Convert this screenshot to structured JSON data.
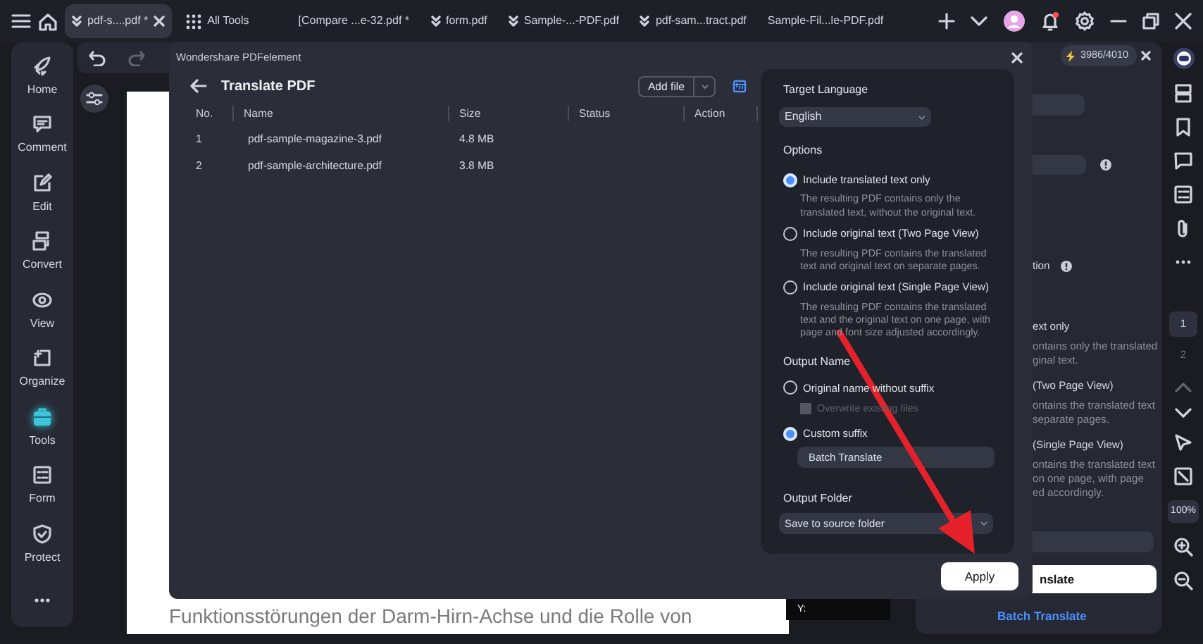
{
  "tabs": [
    {
      "label": "pdf-s....pdf *",
      "selected": true,
      "kind": "file"
    },
    {
      "label": "All Tools",
      "selected": false,
      "kind": "tools"
    },
    {
      "label": "[Compare ...e-32.pdf *",
      "selected": false,
      "kind": "plain"
    },
    {
      "label": "form.pdf",
      "selected": false,
      "kind": "file"
    },
    {
      "label": "Sample-...-PDF.pdf",
      "selected": false,
      "kind": "file"
    },
    {
      "label": "pdf-sam...tract.pdf",
      "selected": false,
      "kind": "file"
    },
    {
      "label": "Sample-Fil...le-PDF.pdf",
      "selected": false,
      "kind": "plain"
    }
  ],
  "sidebar": {
    "items": [
      {
        "label": "Home",
        "selected": false
      },
      {
        "label": "Comment",
        "selected": false
      },
      {
        "label": "Edit",
        "selected": false
      },
      {
        "label": "Convert",
        "selected": false
      },
      {
        "label": "View",
        "selected": false
      },
      {
        "label": "Organize",
        "selected": false
      },
      {
        "label": "Tools",
        "selected": true
      },
      {
        "label": "Form",
        "selected": false
      },
      {
        "label": "Protect",
        "selected": false
      }
    ]
  },
  "document": {
    "text_line": "Funktionsstörungen der Darm-Hirn-Achse und die Rolle von",
    "tooltip": "Y:"
  },
  "right_panel": {
    "credits": "3986/4010",
    "fragments": [
      {
        "text": "tion",
        "info": true
      },
      {
        "text": "ext only",
        "info": false
      },
      {
        "text": "ontains only the translated",
        "info": false
      },
      {
        "text": "ginal text.",
        "info": false
      },
      {
        "text": "(Two Page View)",
        "info": false
      },
      {
        "text": "ontains the translated text",
        "info": false
      },
      {
        "text": "separate pages.",
        "info": false
      },
      {
        "text": "(Single Page View)",
        "info": false
      },
      {
        "text": "ontains the translated text",
        "info": false
      },
      {
        "text": "on one page, with page",
        "info": false
      },
      {
        "text": "ed accordingly.",
        "info": false
      }
    ],
    "button": "nslate",
    "link": "Batch Translate"
  },
  "rail": {
    "pages": [
      {
        "label": "1",
        "selected": true
      },
      {
        "label": "2",
        "selected": false
      }
    ],
    "zoom": "100%"
  },
  "dialog": {
    "app_title": "Wondershare PDFelement",
    "title": "Translate PDF",
    "add_file": "Add file",
    "columns": [
      "No.",
      "Name",
      "Size",
      "Status",
      "Action"
    ],
    "rows": [
      [
        "1",
        "pdf-sample-magazine-3.pdf",
        "4.8 MB"
      ],
      [
        "2",
        "pdf-sample-architecture.pdf",
        "3.8 MB"
      ]
    ],
    "settings": {
      "target_language_label": "Target Language",
      "language": "English",
      "options_label": "Options",
      "options": [
        {
          "label": "Include translated text only",
          "description": "The resulting PDF contains only the translated text, without the original text.",
          "selected": true
        },
        {
          "label": "Include original text (Two Page View)",
          "description": "The resulting PDF contains the translated text and original text on separate pages.",
          "selected": false
        },
        {
          "label": "Include original text (Single Page View)",
          "description": "The resulting PDF contains the translated text and the original text on one page, with page and font size adjusted accordingly.",
          "selected": false
        }
      ],
      "output_name_label": "Output Name",
      "name_options": [
        {
          "label": "Original name without suffix",
          "selected": false
        },
        {
          "label": "Custom suffix",
          "selected": true
        }
      ],
      "overwrite": {
        "label": "Overwrite existing files",
        "checked": false,
        "disabled": true
      },
      "suffix": "Batch Translate",
      "output_folder_label": "Output Folder",
      "folder": "Save to source folder"
    },
    "apply": "Apply"
  }
}
